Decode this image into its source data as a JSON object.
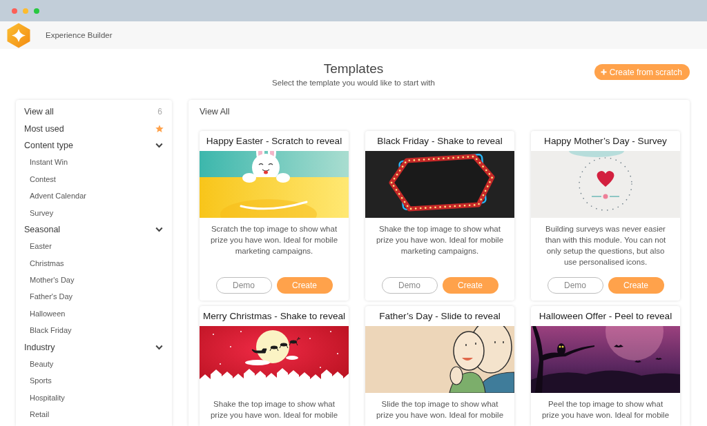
{
  "app": {
    "name": "Experience Builder"
  },
  "header": {
    "title": "Templates",
    "subtitle": "Select the template you would like to start with",
    "action": {
      "label": "Create from scratch"
    }
  },
  "sidebar": {
    "items": [
      {
        "kind": "count",
        "label": "View all",
        "count": "6"
      },
      {
        "kind": "starred",
        "label": "Most used"
      },
      {
        "kind": "group",
        "label": "Content type",
        "expanded": true,
        "children": [
          {
            "label": "Instant Win"
          },
          {
            "label": "Contest"
          },
          {
            "label": "Advent Calendar"
          },
          {
            "label": "Survey"
          }
        ]
      },
      {
        "kind": "group",
        "label": "Seasonal",
        "expanded": true,
        "children": [
          {
            "label": "Easter"
          },
          {
            "label": "Christmas"
          },
          {
            "label": "Mother's Day"
          },
          {
            "label": "Father's Day"
          },
          {
            "label": "Halloween"
          },
          {
            "label": "Black Friday"
          }
        ]
      },
      {
        "kind": "group",
        "label": "Industry",
        "expanded": true,
        "children": [
          {
            "label": "Beauty"
          },
          {
            "label": "Sports"
          },
          {
            "label": "Hospitality"
          },
          {
            "label": "Retail"
          }
        ]
      }
    ]
  },
  "templates": {
    "heading": "View All",
    "cards": [
      {
        "kind": "easter",
        "title": "Happy Easter - Scratch to reveal",
        "description": "Scratch the top image to show what prize you have won. Ideal for mobile marketing campaigns.",
        "actions": [
          {
            "kind": "secondary",
            "label": "Demo"
          },
          {
            "kind": "primary",
            "label": "Create"
          }
        ]
      },
      {
        "kind": "black-friday",
        "title": "Black Friday - Shake to reveal",
        "description": "Shake the top image to show what prize you have won. Ideal for mobile marketing campaigns.",
        "actions": [
          {
            "kind": "secondary",
            "label": "Demo"
          },
          {
            "kind": "primary",
            "label": "Create"
          }
        ]
      },
      {
        "kind": "mothers-day",
        "title": "Happy Mother’s Day - Survey",
        "description": "Building surveys was never easier than with this module. You can not only setup the questions, but also use personalised icons.",
        "actions": [
          {
            "kind": "secondary",
            "label": "Demo"
          },
          {
            "kind": "primary",
            "label": "Create"
          }
        ]
      },
      {
        "kind": "christmas",
        "title": "Merry Christmas - Shake to reveal",
        "description": "Shake the top image to show what prize you have won. Ideal for mobile"
      },
      {
        "kind": "fathers-day",
        "title": "Father’s Day - Slide to reveal",
        "description": "Slide the top image to show what prize you have won. Ideal for mobile"
      },
      {
        "kind": "halloween",
        "title": "Halloween Offer - Peel to reveal",
        "description": "Peel the top image to show what prize you have won. Ideal for mobile"
      }
    ]
  }
}
